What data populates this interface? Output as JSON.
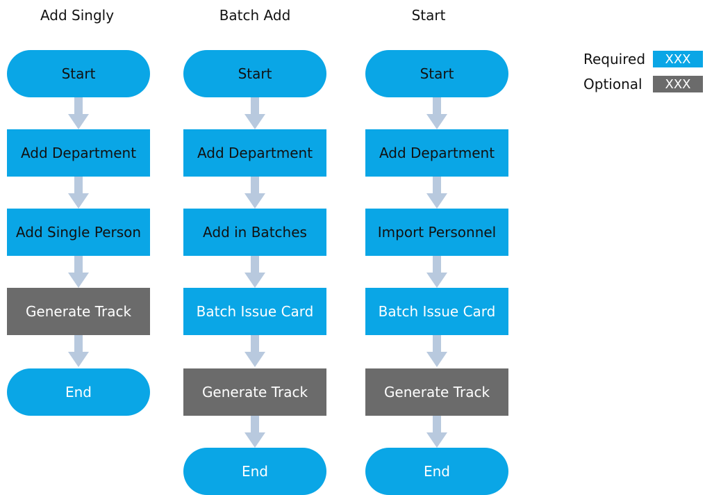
{
  "columns": [
    {
      "title": "Add Singly",
      "steps": [
        {
          "label": "Start",
          "type": "required",
          "shape": "pill"
        },
        {
          "label": "Add Department",
          "type": "required",
          "shape": "rect"
        },
        {
          "label": "Add Single Person",
          "type": "required",
          "shape": "rect"
        },
        {
          "label": "Generate Track",
          "type": "optional",
          "shape": "rect"
        },
        {
          "label": "End",
          "type": "required",
          "shape": "pill"
        }
      ]
    },
    {
      "title": "Batch Add",
      "steps": [
        {
          "label": "Start",
          "type": "required",
          "shape": "pill"
        },
        {
          "label": "Add Department",
          "type": "required",
          "shape": "rect"
        },
        {
          "label": "Add in Batches",
          "type": "required",
          "shape": "rect"
        },
        {
          "label": "Batch Issue Card",
          "type": "required",
          "shape": "rect"
        },
        {
          "label": "Generate Track",
          "type": "optional",
          "shape": "rect"
        },
        {
          "label": "End",
          "type": "required",
          "shape": "pill"
        }
      ]
    },
    {
      "title": "Start",
      "steps": [
        {
          "label": "Start",
          "type": "required",
          "shape": "pill"
        },
        {
          "label": "Add Department",
          "type": "required",
          "shape": "rect"
        },
        {
          "label": "Import Personnel",
          "type": "required",
          "shape": "rect"
        },
        {
          "label": "Batch Issue Card",
          "type": "required",
          "shape": "rect"
        },
        {
          "label": "Generate Track",
          "type": "optional",
          "shape": "rect"
        },
        {
          "label": "End",
          "type": "required",
          "shape": "pill"
        }
      ]
    }
  ],
  "legend": [
    {
      "label": "Required",
      "swatch_text": "XXX",
      "type": "required"
    },
    {
      "label": "Optional",
      "swatch_text": "XXX",
      "type": "optional"
    }
  ],
  "colors": {
    "required": "#0aa6e6",
    "optional": "#6b6b6b",
    "arrow": "#b8c9de"
  }
}
